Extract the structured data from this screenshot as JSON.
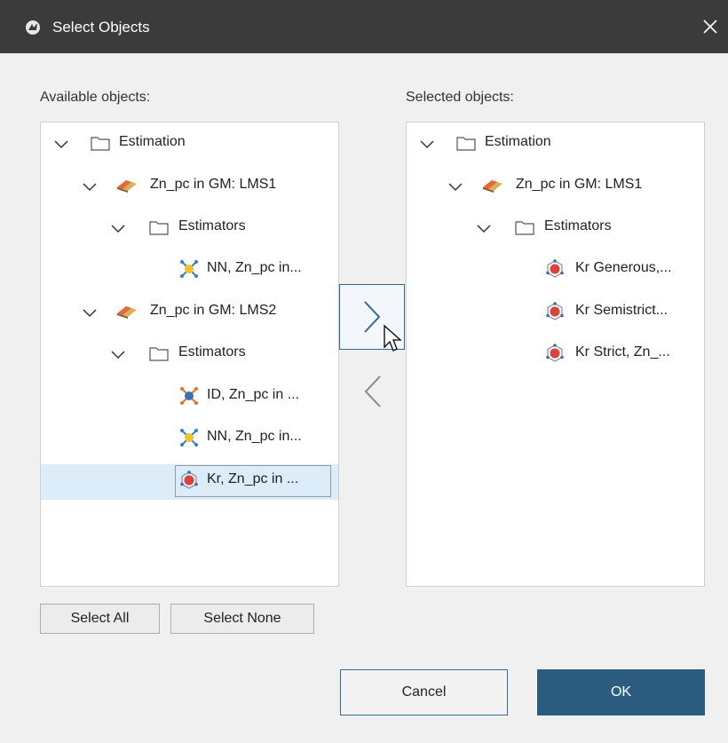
{
  "window": {
    "title": "Select Objects",
    "icon": "app-logo-icon",
    "close_icon": "close-icon"
  },
  "available": {
    "label": "Available objects:",
    "items": [
      {
        "label": "Estimation",
        "icon": "folder-icon",
        "expanded": true
      },
      {
        "label": "Zn_pc in GM: LMS1",
        "icon": "geological-model-icon",
        "expanded": true
      },
      {
        "label": "Estimators",
        "icon": "folder-icon",
        "expanded": true
      },
      {
        "label": "NN, Zn_pc in...",
        "icon": "nearest-neighbour-estimator-icon"
      },
      {
        "label": "Zn_pc in GM: LMS2",
        "icon": "geological-model-icon",
        "expanded": true
      },
      {
        "label": "Estimators",
        "icon": "folder-icon",
        "expanded": true
      },
      {
        "label": "ID, Zn_pc in ...",
        "icon": "inverse-distance-estimator-icon"
      },
      {
        "label": "NN, Zn_pc in...",
        "icon": "nearest-neighbour-estimator-icon"
      },
      {
        "label": "Kr, Zn_pc in ...",
        "icon": "kriging-estimator-icon",
        "selected": true
      }
    ]
  },
  "selected": {
    "label": "Selected objects:",
    "items": [
      {
        "label": "Estimation",
        "icon": "folder-icon",
        "expanded": true
      },
      {
        "label": "Zn_pc in GM: LMS1",
        "icon": "geological-model-icon",
        "expanded": true
      },
      {
        "label": "Estimators",
        "icon": "folder-icon",
        "expanded": true
      },
      {
        "label": "Kr Generous,...",
        "icon": "kriging-estimator-icon"
      },
      {
        "label": "Kr Semistrict...",
        "icon": "kriging-estimator-icon"
      },
      {
        "label": "Kr Strict, Zn_...",
        "icon": "kriging-estimator-icon"
      }
    ]
  },
  "transfer": {
    "add_icon": "chevron-right-icon",
    "remove_icon": "chevron-left-icon"
  },
  "buttons": {
    "select_all": "Select All",
    "select_none": "Select None",
    "cancel": "Cancel",
    "ok": "OK"
  },
  "colors": {
    "titlebar": "#3b3b3b",
    "accent": "#2c5d80",
    "selection": "#dcedf9"
  }
}
